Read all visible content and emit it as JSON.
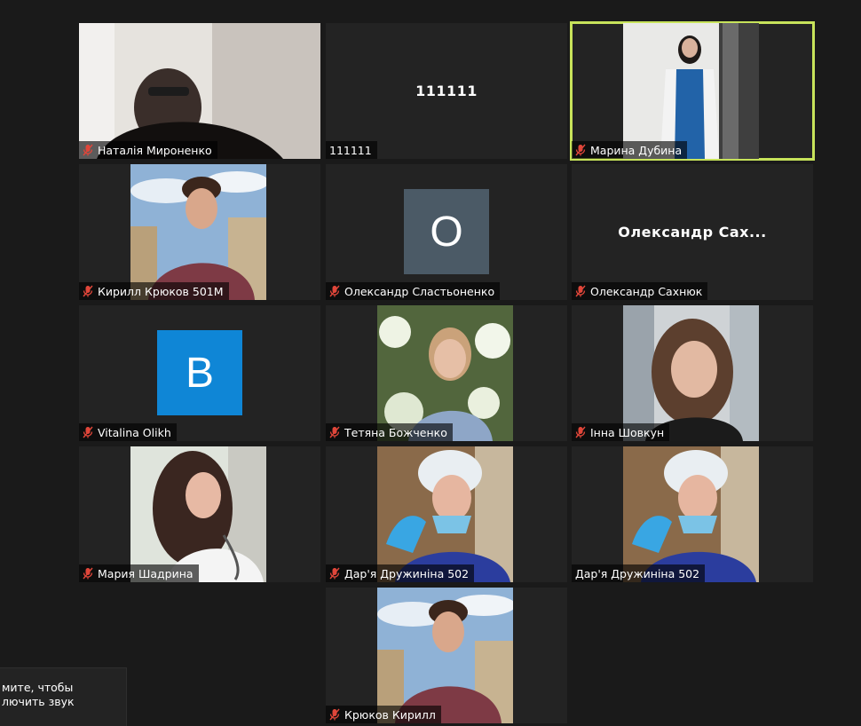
{
  "colors": {
    "active_speaker_border": "#c7e35a",
    "muted_icon": "#e0463a",
    "avatar_o": "#4b5a66",
    "avatar_b": "#0f86d6"
  },
  "participants": [
    {
      "name": "Наталія Мироненко"
    },
    {
      "name": "111111",
      "center_text": "111111"
    },
    {
      "name": "Марина Дубина"
    },
    {
      "name": "Кирилл Крюков 501М"
    },
    {
      "name": "Олександр Сластьоненко",
      "avatar_letter": "O"
    },
    {
      "name": "Олександр Сахнюк",
      "center_text": "Олександр Сах..."
    },
    {
      "name": "Vitalina Olikh",
      "avatar_letter": "B"
    },
    {
      "name": "Тетяна Божченко"
    },
    {
      "name": "Інна Шовкун"
    },
    {
      "name": "Мария Шадрина"
    },
    {
      "name": "Дар'я Дружиніна 502"
    },
    {
      "name": "Дар'я Дружиніна 502"
    },
    {
      "name": "Крюков Кирилл"
    }
  ],
  "toast": {
    "line1": "мите, чтобы",
    "line2": "лючить звук"
  },
  "icons": {
    "mic_muted": "mic-muted-icon"
  }
}
